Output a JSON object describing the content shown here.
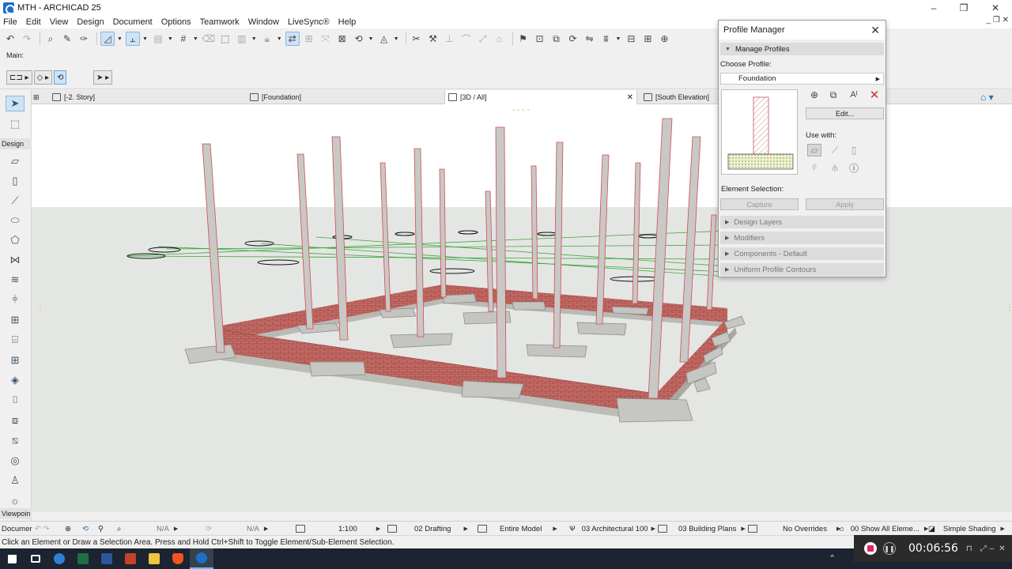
{
  "window": {
    "title": "MTH - ARCHICAD 25",
    "controls": {
      "minimize": "–",
      "maximize": "❐",
      "close": "✕"
    }
  },
  "menu": [
    "File",
    "Edit",
    "View",
    "Design",
    "Document",
    "Options",
    "Teamwork",
    "Window",
    "LiveSync®",
    "Help"
  ],
  "infobox": {
    "label": "Main:"
  },
  "toolbox": {
    "design_label": "Design",
    "viewpoint_label": "Viewpoin",
    "document_label": "Documer"
  },
  "tabs": [
    {
      "label": "[-2. Story]",
      "icon": "floor-plan-icon"
    },
    {
      "label": "[Foundation]",
      "icon": "section-icon"
    },
    {
      "label": "[3D / All]",
      "icon": "3d-icon",
      "active": true,
      "close": "✕"
    },
    {
      "label": "[South Elevation]",
      "icon": "elevation-icon"
    }
  ],
  "quick_options": {
    "na_1": "N/A",
    "na_2": "N/A",
    "scale": "1:100",
    "layer_combo": "02 Drafting",
    "model_view": "Entire Model",
    "pen_set": "03 Architectural 100",
    "mvo": "03 Building Plans",
    "graphic_override": "No Overrides",
    "renovation": "00 Show All Eleme...",
    "shading": "Simple Shading"
  },
  "status_text": "Click an Element or Draw a Selection Area. Press and Hold Ctrl+Shift to Toggle Element/Sub-Element Selection.",
  "recorder": {
    "time": "00:06:56"
  },
  "profile_manager": {
    "title": "Profile Manager",
    "manage_profiles": "Manage Profiles",
    "choose_profile_label": "Choose Profile:",
    "selected_profile": "Foundation",
    "edit_button": "Edit...",
    "use_with_label": "Use with:",
    "element_selection_label": "Element Selection:",
    "capture_button": "Capture",
    "apply_button": "Apply",
    "sections": [
      "Design Layers",
      "Modifiers",
      "Components - Default",
      "Uniform Profile Contours"
    ]
  },
  "colors": {
    "accent": "#cfe3f7",
    "brick": "#b85a5a",
    "concrete": "#c4c4c0",
    "ground": "#e3e5e3",
    "taskbar": "#1b2430"
  }
}
